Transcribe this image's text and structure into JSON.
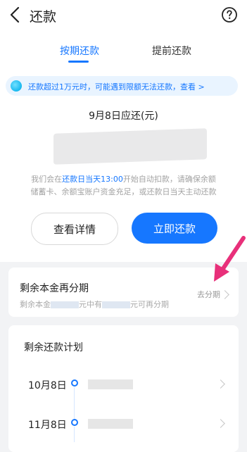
{
  "header": {
    "title": "还款",
    "back_icon": "chevron-left-icon",
    "help_icon": "question-circle-icon"
  },
  "tabs": [
    {
      "label": "按期还款",
      "active": true
    },
    {
      "label": "提前还款",
      "active": false
    }
  ],
  "notice": {
    "text": "还款超过1万元时，可能遇到限额无法还款，查看 >",
    "icon": "info-dot-icon"
  },
  "due": {
    "title": "9月8日应还(元)"
  },
  "description": {
    "line1_prefix": "我们会在",
    "line1_highlight": "还款日当天13:00",
    "line1_suffix": "开始自动扣款，请确保余额",
    "line2": "储蓄卡、余额宝账户资金充足，或还款日当天主动还款"
  },
  "buttons": {
    "details": "查看详情",
    "repay_now": "立即还款"
  },
  "installment": {
    "title": "剩余本金再分期",
    "subtitle_prefix": "剩余本金",
    "subtitle_middle": "元中有",
    "subtitle_suffix": "元可再分期",
    "action": "去分期"
  },
  "plan": {
    "title": "剩余还款计划",
    "items": [
      {
        "date": "10月8日"
      },
      {
        "date": "11月8日"
      }
    ]
  },
  "colors": {
    "accent": "#1677ff",
    "annotation_arrow": "#e8307a"
  }
}
